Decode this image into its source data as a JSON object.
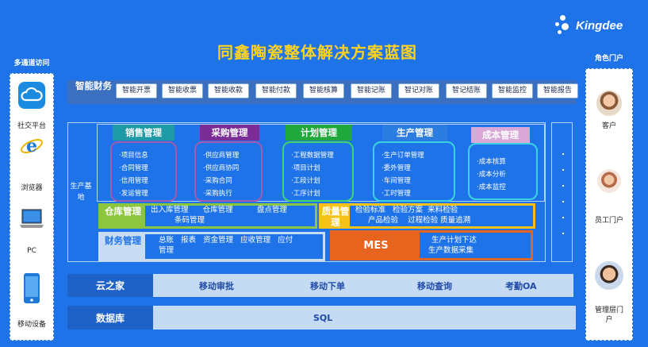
{
  "brand": {
    "logo_text": "Kingdee"
  },
  "title": "同鑫陶瓷整体解决方案蓝图",
  "left_panel": {
    "title": "多通道访问",
    "items": [
      {
        "label": "社交平台",
        "icon": "cloud-icon"
      },
      {
        "label": "浏览器",
        "icon": "ie-browser-icon"
      },
      {
        "label": "PC",
        "icon": "laptop-icon"
      },
      {
        "label": "移动设备",
        "icon": "mobile-phone-icon"
      }
    ]
  },
  "right_panel": {
    "title": "角色门户",
    "items": [
      {
        "label": "客户",
        "icon": "customer-avatar"
      },
      {
        "label": "员工门户",
        "icon": "employee-avatar"
      },
      {
        "label": "管理层门户",
        "icon": "manager-avatar"
      }
    ]
  },
  "smart_finance": {
    "label": "智能财务",
    "items": [
      "智能开票",
      "智能收票",
      "智能收款",
      "智能付款",
      "智能核算",
      "智能记账",
      "智记对账",
      "智记结账",
      "智能监控",
      "智能报告"
    ]
  },
  "production_base": {
    "label": "生产基地"
  },
  "modules": [
    {
      "key": "sales",
      "title": "销售管理",
      "items": [
        "·项目信息",
        "·合同管理",
        "·信用管理",
        "·发运管理"
      ],
      "head_color": "#1e9aa6",
      "border_color": "#a15bb0"
    },
    {
      "key": "purchase",
      "title": "采购管理",
      "items": [
        "·供应商管理",
        "·供应商协同",
        "·采购合同",
        "·采购执行"
      ],
      "head_color": "#7b2d97",
      "border_color": "#a15bb0"
    },
    {
      "key": "plan",
      "title": "计划管理",
      "items": [
        "·工程数据管理",
        "·项目计划",
        "·工段计划",
        "·工序计划"
      ],
      "head_color": "#21a83d",
      "border_color": "#3fd56a"
    },
    {
      "key": "production",
      "title": "生产管理",
      "items": [
        "·生产订单管理",
        "·委外管理",
        "·车间管理",
        "·工时管理"
      ],
      "head_color": "#2c7de0",
      "border_color": "#39d4e0"
    },
    {
      "key": "cost",
      "title": "成本管理",
      "items": [
        "·成本核算",
        "·成本分析",
        "·成本监控"
      ],
      "head_color": "#d9a7d8",
      "border_color": "#39d4e0"
    }
  ],
  "warehouse": {
    "label": "仓库管理",
    "items_line1": "出入库管理      仓库管理          盘点管理",
    "items_line2": "条码管理"
  },
  "quality": {
    "label": "质量管理",
    "items_line1": "检验标准   检验方案  来料检验",
    "items_line2": "产品检验    过程检验 质量追溯"
  },
  "finance_mgmt": {
    "label": "财务管理",
    "items_line1": "总账   报表   资金管理   应收管理   应付",
    "items_line2": "管理"
  },
  "mes": {
    "label": "MES",
    "items_line1": "生产计划下达",
    "items_line2": "生产数据采集"
  },
  "cloud_home": {
    "label": "云之家",
    "items": [
      "移动审批",
      "移动下单",
      "移动查询",
      "考勤OA"
    ]
  },
  "database": {
    "label": "数据库",
    "item": "SQL"
  },
  "colors": {
    "background": "#1f73e8",
    "title": "#ffd21f",
    "warehouse_green": "#8cc63f",
    "quality_yellow": "#f6c21a",
    "mes_orange": "#e7641e"
  }
}
